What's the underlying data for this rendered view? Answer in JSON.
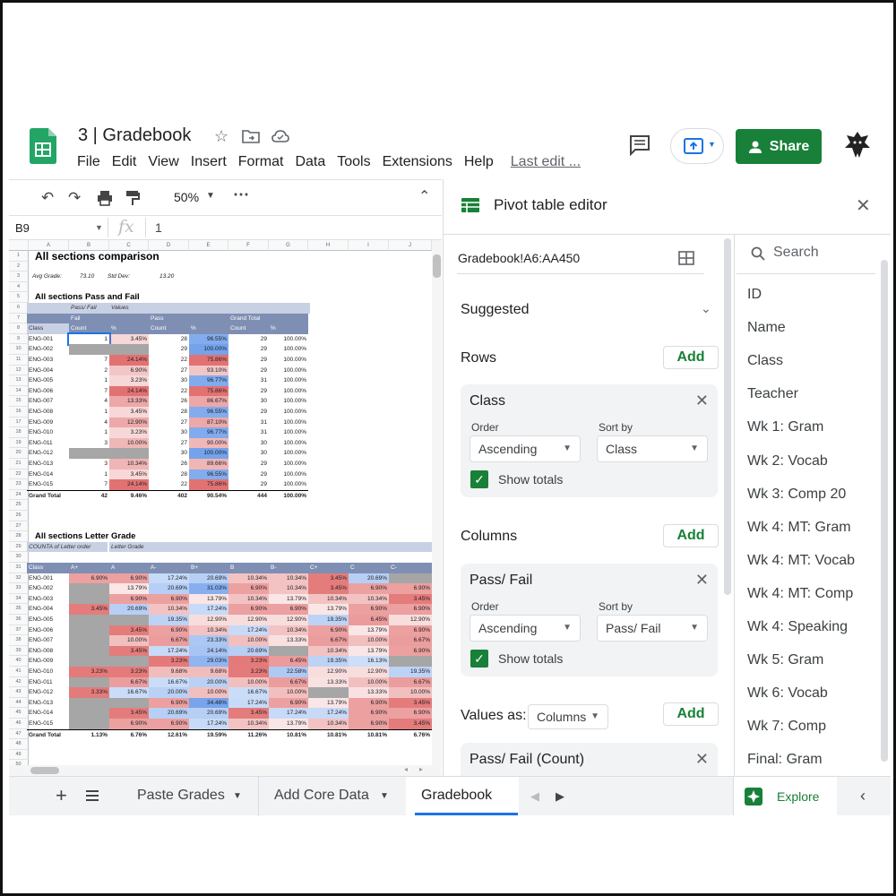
{
  "doc": {
    "title": "3 | Gradebook",
    "menu": [
      "File",
      "Edit",
      "View",
      "Insert",
      "Format",
      "Data",
      "Tools",
      "Extensions",
      "Help"
    ],
    "last_edit": "Last edit ...",
    "share_label": "Share"
  },
  "toolbar": {
    "zoom": "50%"
  },
  "formula": {
    "cell_ref": "B9",
    "fx": "fx",
    "value": "1"
  },
  "sheet": {
    "columns": [
      "A",
      "B",
      "C",
      "D",
      "E",
      "F",
      "G",
      "H",
      "I",
      "J"
    ],
    "title": "All sections comparison",
    "avg_label": "Avg Grade:",
    "avg_value": "73.10",
    "std_label": "Std Dev:",
    "std_value": "13.20",
    "pf_title": "All sections Pass and Fail",
    "pf_hdr": {
      "passfail": "Pass/ Fail",
      "values": "Values",
      "fail": "Fail",
      "pass": "Pass",
      "grand_total": "Grand Total",
      "class": "Class",
      "count": "Count",
      "pct": "%"
    },
    "pf_rows": [
      [
        "ENG-001",
        "1",
        "3.45%",
        "28",
        "96.55%",
        "29",
        "100.00%"
      ],
      [
        "ENG-002",
        "",
        "",
        "29",
        "100.00%",
        "29",
        "100.00%"
      ],
      [
        "ENG-003",
        "7",
        "24.14%",
        "22",
        "75.86%",
        "29",
        "100.00%"
      ],
      [
        "ENG-004",
        "2",
        "6.90%",
        "27",
        "93.10%",
        "29",
        "100.00%"
      ],
      [
        "ENG-005",
        "1",
        "3.23%",
        "30",
        "96.77%",
        "31",
        "100.00%"
      ],
      [
        "ENG-006",
        "7",
        "24.14%",
        "22",
        "75.86%",
        "29",
        "100.00%"
      ],
      [
        "ENG-007",
        "4",
        "13.33%",
        "26",
        "86.67%",
        "30",
        "100.00%"
      ],
      [
        "ENG-008",
        "1",
        "3.45%",
        "28",
        "96.55%",
        "29",
        "100.00%"
      ],
      [
        "ENG-009",
        "4",
        "12.90%",
        "27",
        "87.10%",
        "31",
        "100.00%"
      ],
      [
        "ENG-010",
        "1",
        "3.23%",
        "30",
        "96.77%",
        "31",
        "100.00%"
      ],
      [
        "ENG-011",
        "3",
        "10.00%",
        "27",
        "90.00%",
        "30",
        "100.00%"
      ],
      [
        "ENG-012",
        "",
        "",
        "30",
        "100.00%",
        "30",
        "100.00%"
      ],
      [
        "ENG-013",
        "3",
        "10.34%",
        "26",
        "89.66%",
        "29",
        "100.00%"
      ],
      [
        "ENG-014",
        "1",
        "3.45%",
        "28",
        "96.55%",
        "29",
        "100.00%"
      ],
      [
        "ENG-015",
        "7",
        "24.14%",
        "22",
        "75.86%",
        "29",
        "100.00%"
      ]
    ],
    "pf_total": [
      "Grand Total",
      "42",
      "9.46%",
      "402",
      "90.54%",
      "444",
      "100.00%"
    ],
    "lg_title": "All sections Letter Grade",
    "lg_sub1": "COUNTA of Letter order",
    "lg_sub2": "Letter Grade",
    "lg_hdr": [
      "Class",
      "A+",
      "A",
      "A-",
      "B+",
      "B",
      "B-",
      "C+",
      "C",
      "C-"
    ],
    "lg_rows": [
      [
        "ENG-001",
        "6.90%",
        "6.90%",
        "17.24%",
        "20.69%",
        "10.34%",
        "10.34%",
        "3.45%",
        "20.69%",
        ""
      ],
      [
        "ENG-002",
        "",
        "13.79%",
        "20.69%",
        "31.03%",
        "6.90%",
        "10.34%",
        "3.45%",
        "6.90%",
        "6.90%"
      ],
      [
        "ENG-003",
        "",
        "6.90%",
        "6.90%",
        "13.79%",
        "10.34%",
        "13.79%",
        "10.34%",
        "10.34%",
        "3.45%"
      ],
      [
        "ENG-004",
        "3.45%",
        "20.69%",
        "10.34%",
        "17.24%",
        "6.90%",
        "6.90%",
        "13.79%",
        "6.90%",
        "6.90%"
      ],
      [
        "ENG-005",
        "",
        "",
        "19.35%",
        "12.90%",
        "12.90%",
        "12.90%",
        "19.35%",
        "6.45%",
        "12.90%"
      ],
      [
        "ENG-006",
        "",
        "3.45%",
        "6.90%",
        "10.34%",
        "17.24%",
        "10.34%",
        "6.90%",
        "13.79%",
        "6.90%"
      ],
      [
        "ENG-007",
        "",
        "10.00%",
        "6.67%",
        "23.33%",
        "10.00%",
        "13.33%",
        "6.67%",
        "10.00%",
        "6.67%"
      ],
      [
        "ENG-008",
        "",
        "3.45%",
        "17.24%",
        "24.14%",
        "20.69%",
        "",
        "10.34%",
        "13.79%",
        "6.90%"
      ],
      [
        "ENG-009",
        "",
        "",
        "3.23%",
        "29.03%",
        "3.23%",
        "6.45%",
        "19.35%",
        "16.13%",
        ""
      ],
      [
        "ENG-010",
        "3.23%",
        "3.23%",
        "9.68%",
        "9.68%",
        "3.23%",
        "22.58%",
        "12.90%",
        "12.90%",
        "19.35%"
      ],
      [
        "ENG-011",
        "",
        "6.67%",
        "16.67%",
        "20.00%",
        "10.00%",
        "6.67%",
        "13.33%",
        "10.00%",
        "6.67%"
      ],
      [
        "ENG-012",
        "3.33%",
        "16.67%",
        "20.00%",
        "10.00%",
        "16.67%",
        "10.00%",
        "",
        "13.33%",
        "10.00%"
      ],
      [
        "ENG-013",
        "",
        "",
        "6.90%",
        "34.48%",
        "17.24%",
        "6.90%",
        "13.79%",
        "6.90%",
        "3.45%"
      ],
      [
        "ENG-014",
        "",
        "3.45%",
        "20.69%",
        "20.69%",
        "3.45%",
        "17.24%",
        "17.24%",
        "6.90%",
        "6.90%"
      ],
      [
        "ENG-015",
        "",
        "6.90%",
        "6.90%",
        "17.24%",
        "10.34%",
        "13.79%",
        "10.34%",
        "6.90%",
        "3.45%"
      ]
    ],
    "lg_total": [
      "Grand Total",
      "1.13%",
      "6.76%",
      "12.61%",
      "19.59%",
      "11.26%",
      "10.81%",
      "10.81%",
      "10.81%",
      "6.76%"
    ]
  },
  "tabs": [
    "Paste Grades",
    "Add Core Data",
    "Gradebook"
  ],
  "explore_label": "Explore",
  "pivot": {
    "title": "Pivot table editor",
    "range": "Gradebook!A6:AA450",
    "suggested": "Suggested",
    "rows_label": "Rows",
    "columns_label": "Columns",
    "values_label": "Values as:",
    "values_select": "Columns",
    "add": "Add",
    "order_label": "Order",
    "sortby_label": "Sort by",
    "show_totals": "Show totals",
    "row_card": {
      "title": "Class",
      "order": "Ascending",
      "sort": "Class"
    },
    "col_card": {
      "title": "Pass/ Fail",
      "order": "Ascending",
      "sort": "Pass/ Fail"
    },
    "val_card": {
      "title": "Pass/ Fail (Count)"
    },
    "search_placeholder": "Search",
    "fields": [
      "ID",
      "Name",
      "Class",
      "Teacher",
      "Wk 1: Gram",
      "Wk 2: Vocab",
      "Wk 3: Comp 20",
      "Wk 4: MT: Gram",
      "Wk 4: MT: Vocab",
      "Wk 4: MT: Comp",
      "Wk 4: Speaking",
      "Wk 5: Gram",
      "Wk 6: Vocab",
      "Wk 7: Comp",
      "Final: Gram"
    ]
  },
  "colors": {
    "green": "#188038",
    "red_heat": "#e06666",
    "blue_heat": "#6d9eeb",
    "hdr_band": "#7f8fb4"
  }
}
